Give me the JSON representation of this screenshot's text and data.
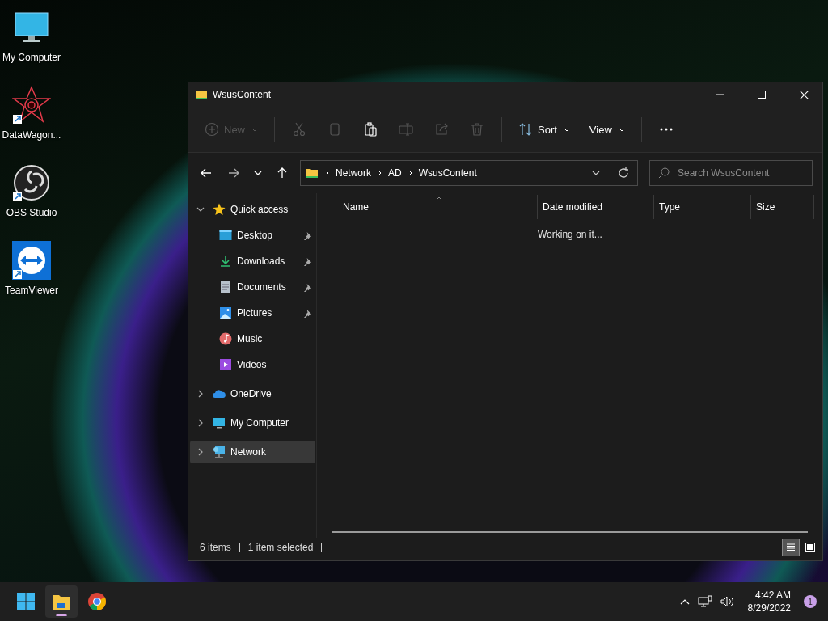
{
  "desktop_icons": [
    {
      "label": "My Computer",
      "kind": "monitor",
      "shortcut": false
    },
    {
      "label": "DataWagon...",
      "kind": "star",
      "shortcut": true
    },
    {
      "label": "OBS Studio",
      "kind": "obs",
      "shortcut": true
    },
    {
      "label": "TeamViewer",
      "kind": "arrows",
      "shortcut": true
    }
  ],
  "window": {
    "title": "WsusContent",
    "toolbar": [
      {
        "kind": "new",
        "label": "New",
        "disabled": true
      },
      {
        "kind": "cut",
        "disabled": true
      },
      {
        "kind": "copy",
        "disabled": true
      },
      {
        "kind": "paste",
        "disabled": false
      },
      {
        "kind": "rename",
        "disabled": true
      },
      {
        "kind": "share",
        "disabled": true
      },
      {
        "kind": "delete",
        "disabled": true
      },
      {
        "kind": "sort",
        "label": "Sort",
        "disabled": false
      },
      {
        "kind": "view",
        "label": "View",
        "disabled": false
      },
      {
        "kind": "more",
        "disabled": false
      }
    ],
    "address": {
      "path": [
        "Network",
        "AD",
        "WsusContent"
      ]
    },
    "search": {
      "placeholder": "Search WsusContent"
    },
    "sidebar": {
      "items": [
        {
          "label": "Quick access",
          "kind": "star",
          "expanded": true,
          "selected": false,
          "children": [
            {
              "label": "Desktop",
              "kind": "desktop",
              "pinned": true,
              "selected": false
            },
            {
              "label": "Downloads",
              "kind": "download",
              "pinned": true,
              "selected": false
            },
            {
              "label": "Documents",
              "kind": "document",
              "pinned": true,
              "selected": false
            },
            {
              "label": "Pictures",
              "kind": "picture",
              "pinned": true,
              "selected": false
            },
            {
              "label": "Music",
              "kind": "music",
              "pinned": false,
              "selected": false
            },
            {
              "label": "Videos",
              "kind": "video",
              "pinned": false,
              "selected": false
            }
          ]
        },
        {
          "label": "OneDrive",
          "kind": "cloud",
          "expanded": false,
          "selected": false
        },
        {
          "label": "My Computer",
          "kind": "monitor",
          "expanded": false,
          "selected": false
        },
        {
          "label": "Network",
          "kind": "network",
          "expanded": false,
          "selected": true
        }
      ]
    },
    "table": {
      "columns": [
        {
          "label": "Name",
          "sorted": true
        },
        {
          "label": "Date modified",
          "sorted": false
        },
        {
          "label": "Type",
          "sorted": false
        },
        {
          "label": "Size",
          "sorted": false
        }
      ],
      "message": "Working on it..."
    },
    "status_bar": {
      "items": [
        "6 items",
        "1 item selected"
      ],
      "views": [
        {
          "kind": "details",
          "selected": true
        },
        {
          "kind": "tiles",
          "selected": false
        }
      ]
    }
  },
  "taskbar": {
    "apps": [
      {
        "kind": "start",
        "active": false
      },
      {
        "kind": "explorer",
        "active": true
      },
      {
        "kind": "chrome",
        "active": false
      }
    ],
    "time": "4:42 AM",
    "date": "8/29/2022",
    "notifications": "1"
  }
}
